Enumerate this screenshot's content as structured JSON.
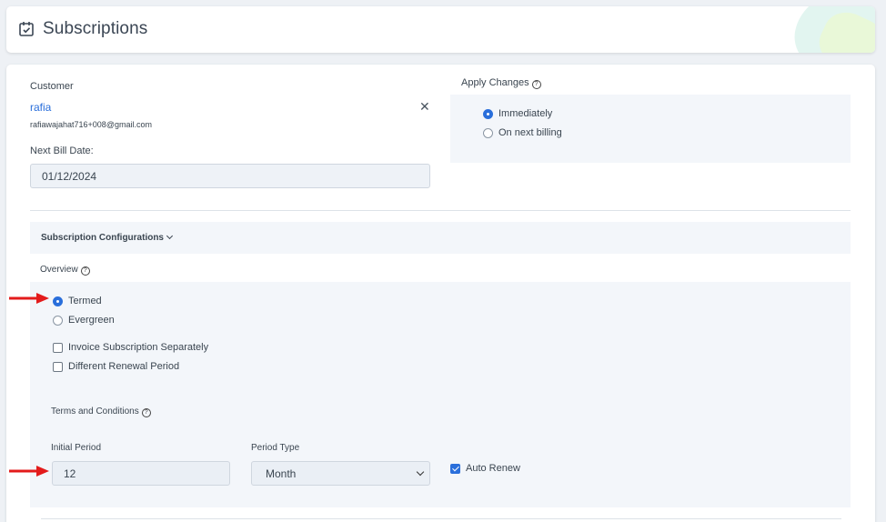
{
  "header": {
    "title": "Subscriptions",
    "icon": "calendar-check-icon"
  },
  "customer": {
    "label": "Customer",
    "name": "rafia",
    "email": "rafiawajahat716+008@gmail.com",
    "clear_icon": "close-icon"
  },
  "next_bill": {
    "label": "Next Bill Date:",
    "value": "01/12/2024"
  },
  "apply_changes": {
    "label": "Apply Changes",
    "options": [
      {
        "label": "Immediately",
        "selected": true
      },
      {
        "label": "On next billing",
        "selected": false
      }
    ]
  },
  "config": {
    "title": "Subscription Configurations",
    "overview_label": "Overview",
    "term_options": [
      {
        "label": "Termed",
        "selected": true
      },
      {
        "label": "Evergreen",
        "selected": false
      }
    ],
    "checkboxes": [
      {
        "label": "Invoice Subscription Separately",
        "checked": false
      },
      {
        "label": "Different Renewal Period",
        "checked": false
      }
    ],
    "terms_label": "Terms and Conditions",
    "initial_period": {
      "label": "Initial Period",
      "value": "12"
    },
    "period_type": {
      "label": "Period Type",
      "value": "Month"
    },
    "auto_renew": {
      "label": "Auto Renew",
      "checked": true
    }
  },
  "colors": {
    "accent": "#2a6fdb",
    "arrow": "#e31b1b"
  }
}
